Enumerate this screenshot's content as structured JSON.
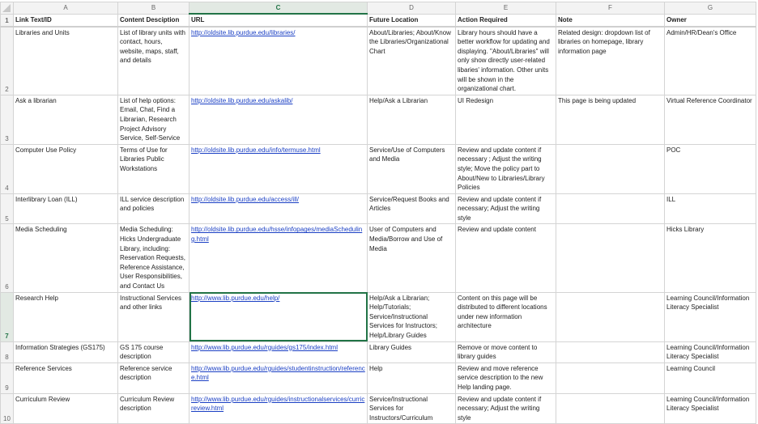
{
  "columns": [
    "A",
    "B",
    "C",
    "D",
    "E",
    "F",
    "G"
  ],
  "selected_column": "C",
  "selected_row": "7",
  "header_row": {
    "num": "1",
    "cells": [
      "Link Text/ID",
      "Content Desciption",
      "URL",
      "Future Location",
      "Action Required",
      "Note",
      "Owner"
    ]
  },
  "rows": [
    {
      "num": "2",
      "cells": [
        "Libraries and Units",
        "List of library units with contact, hours, website, maps, staff, and details",
        "http://oldsite.lib.purdue.edu/libraries/",
        "About/Libraries; About/Know the Libraries/Organizational Chart",
        "Library hours should have a better workflow for updating and displaying. \"About/Libraries\" will only show directly user-related libaries' information. Other units will be shown in the organizational chart.",
        "Related design: dropdown list of libraries on homepage, library information page",
        "Admin/HR/Dean's Office"
      ]
    },
    {
      "num": "3",
      "cells": [
        "Ask a librarian",
        "List of help options: Email, Chat, Find a Librarian, Research Project Advisory Service, Self-Service",
        "http://oldsite.lib.purdue.edu/askalib/",
        "Help/Ask a Librarian",
        "UI Redesign",
        "This page is being updated",
        "Virtual Reference Coordinator"
      ]
    },
    {
      "num": "4",
      "cells": [
        "Computer Use Policy",
        "Terms of Use for Libraries Public Workstations",
        "http://oldsite.lib.purdue.edu/info/termuse.html",
        "Service/Use of Computers and Media",
        "Review and update content if necessary ; Adjust the writing style; Move the policy part to About/New to Libraries/Library Policies",
        "",
        "POC"
      ]
    },
    {
      "num": "5",
      "cells": [
        "Interlibrary Loan (ILL)",
        "ILL service description and policies",
        "http://oldsite.lib.purdue.edu/access/ill/",
        "Service/Request Books and Articles",
        "Review and update content if necessary; Adjust the writing style",
        "",
        "ILL"
      ]
    },
    {
      "num": "6",
      "cells": [
        "Media Scheduling",
        "Media Scheduling: Hicks Undergraduate Library, including: Reservation Requests, Reference Assistance, User Responsibilities, and Contact Us",
        "http://oldsite.lib.purdue.edu/hsse/infopages/mediaScheduling.html",
        "User of Computers and Media/Borrow and Use of Media",
        "Review and update content",
        "",
        "Hicks Library"
      ]
    },
    {
      "num": "7",
      "cells": [
        "Research Help",
        "Instructional Services and other links",
        "http://www.lib.purdue.edu/help/",
        "Help/Ask a Librarian; Help/Tutorials; Service/Instructional Services for Instructors; Help/Library Guides",
        "Content on this page will be distributed to different locations under new information architecture",
        "",
        "Learning Council/Information Literacy Specialist"
      ]
    },
    {
      "num": "8",
      "cells": [
        "Information Strategies (GS175)",
        "GS 175 course description",
        "http://www.lib.purdue.edu/rguides/gs175/index.html",
        "Library Guides",
        "Remove or move content to library guides",
        "",
        "Learning Council/Information Literacy Specialist"
      ]
    },
    {
      "num": "9",
      "cells": [
        "Reference Services",
        "Reference service description",
        "http://www.lib.purdue.edu/rguides/studentinstruction/reference.html",
        "Help",
        "Review and move reference service description to the new Help landing page.",
        "",
        "Learning Council"
      ]
    },
    {
      "num": "10",
      "cells": [
        "Curriculum Review",
        "Curriculum Review description",
        "http://www.lib.purdue.edu/rguides/instructionalservices/curricreview.html",
        "Service/Instructional Services for Instructors/Curriculum",
        "Review and update content if necessary; Adjust the writing style",
        "",
        "Learning Council/Information Literacy Specialist"
      ]
    }
  ]
}
